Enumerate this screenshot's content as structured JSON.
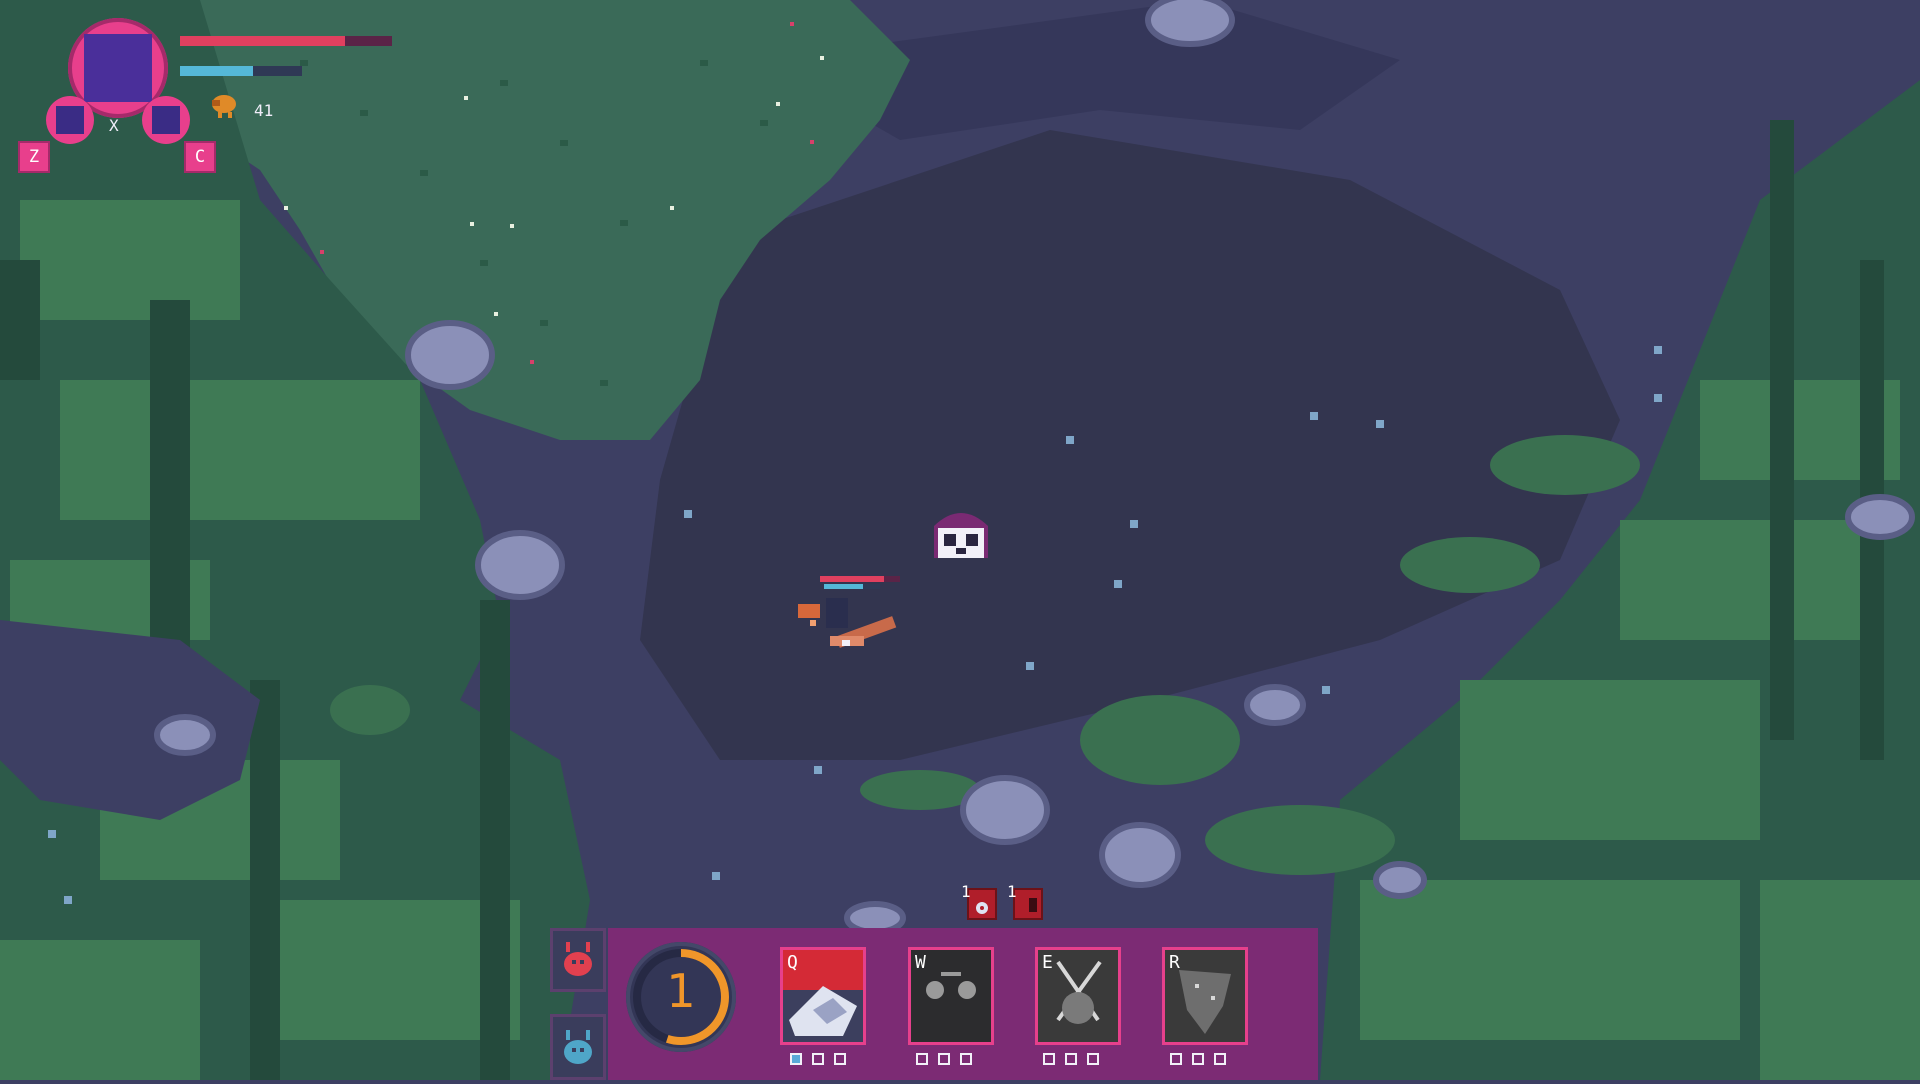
{
  "colors": {
    "health": "#e0405f",
    "mana": "#55b8d8",
    "accent": "#e83f8c",
    "ability_bar": "#7c2b74",
    "cooldown_ring": "#f0962a"
  },
  "player": {
    "health_fraction": 0.78,
    "mana_fraction": 0.6,
    "currency_icon": "coin-bug-icon",
    "currency_count": "41"
  },
  "hud": {
    "slot_keys": {
      "left": "Z",
      "center": "X",
      "right": "C"
    }
  },
  "buffs": [
    {
      "level": "1",
      "icon": "gear-buff-icon"
    },
    {
      "level": "1",
      "icon": "claw-buff-icon"
    }
  ],
  "species": [
    {
      "icon": "red-beetle-icon",
      "selected": true
    },
    {
      "icon": "blue-beetle-icon",
      "selected": false
    }
  ],
  "cooldown": {
    "value": "1",
    "fraction": 0.55
  },
  "abilities": [
    {
      "key": "Q",
      "icon": "slash-ability-icon",
      "pips_filled": 1,
      "pips_total": 3
    },
    {
      "key": "W",
      "icon": "eyes-ability-icon",
      "pips_filled": 0,
      "pips_total": 3
    },
    {
      "key": "E",
      "icon": "crossed-blades-ability-icon",
      "pips_filled": 0,
      "pips_total": 3
    },
    {
      "key": "R",
      "icon": "storm-ability-icon",
      "pips_filled": 0,
      "pips_total": 3
    }
  ]
}
